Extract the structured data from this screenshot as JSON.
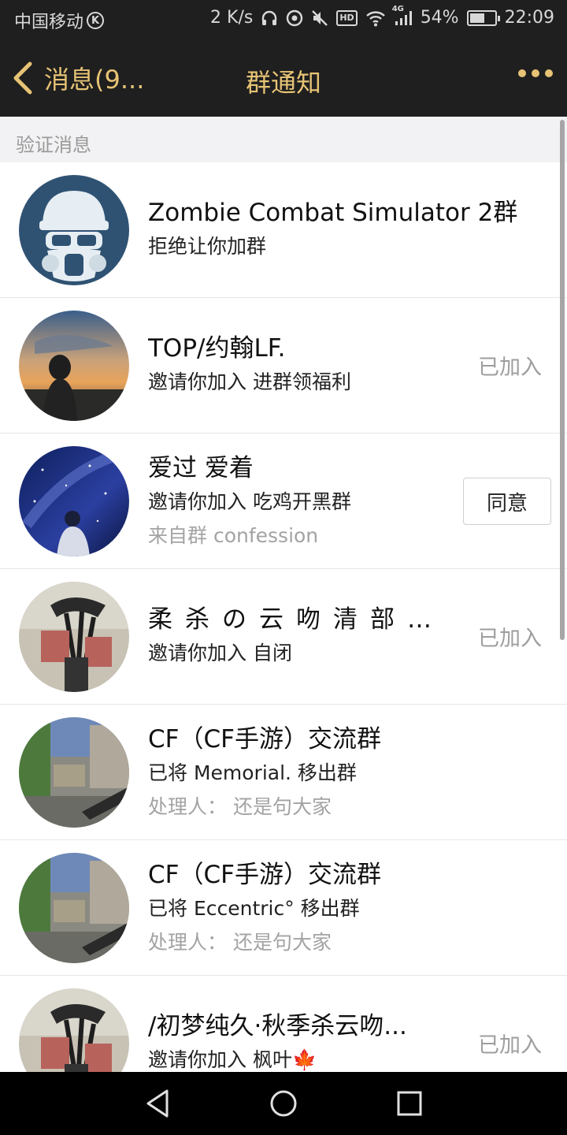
{
  "status_bar": {
    "carrier": "中国移动",
    "net_speed": "2 K/s",
    "network": "4G",
    "battery": "54%",
    "time": "22:09"
  },
  "nav": {
    "back_label": "消息(9...",
    "title": "群通知"
  },
  "section_header": "验证消息",
  "colors": {
    "bar_background": "#1f1f1f",
    "accent_gold": "#e7c375"
  },
  "rows": [
    {
      "title": "Zombie Combat Simulator 2群",
      "subtitle": "拒绝让你加群",
      "extra": "",
      "status": ""
    },
    {
      "title": "TOP/约翰LF.",
      "subtitle": "邀请你加入 进群领福利",
      "extra": "",
      "status": "已加入"
    },
    {
      "title": "爱过 爱着",
      "subtitle": "邀请你加入 吃鸡开黑群",
      "extra": "来自群 confession",
      "action": "同意"
    },
    {
      "title": "柔杀の云吻清部...",
      "subtitle": "邀请你加入 自闭",
      "extra": "",
      "status": "已加入"
    },
    {
      "title": "CF（CF手游）交流群",
      "subtitle": "已将 Memorial. 移出群",
      "extra": "处理人：  还是句大家",
      "status": ""
    },
    {
      "title": "CF（CF手游）交流群",
      "subtitle": "已将 Eccentric° 移出群",
      "extra": "处理人：  还是句大家",
      "status": ""
    },
    {
      "title": "/初梦纯久·秋季杀云吻...",
      "subtitle": "邀请你加入 枫叶🍁",
      "extra": "",
      "status": "已加入"
    }
  ]
}
